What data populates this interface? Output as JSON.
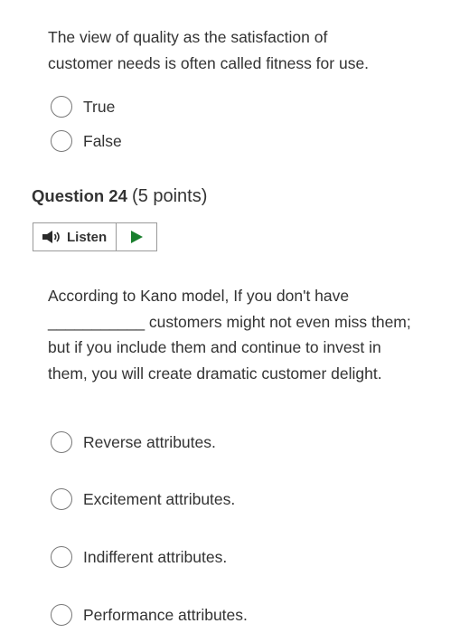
{
  "question_23": {
    "statement_line1": "The view of quality as the satisfaction of",
    "statement_line2": "customer needs is often called fitness for use.",
    "options": [
      "True",
      "False"
    ]
  },
  "question_24": {
    "number_label": "Question 24",
    "points_label": "(5 points)",
    "listen_label": "Listen",
    "prompt_line1": "According to Kano model, If you don't have",
    "prompt_line2": "___________ customers might not even miss them;",
    "prompt_line3": "but if you include them and continue to invest in",
    "prompt_line4": "them, you will create dramatic customer delight.",
    "options": [
      "Reverse attributes.",
      "Excitement attributes.",
      "Indifferent attributes.",
      "Performance attributes."
    ]
  },
  "colors": {
    "text": "#333333",
    "play_arrow": "#1a7f2e",
    "radio_border": "#777777"
  },
  "icons": {
    "speaker": "speaker-icon",
    "play": "play-icon"
  }
}
